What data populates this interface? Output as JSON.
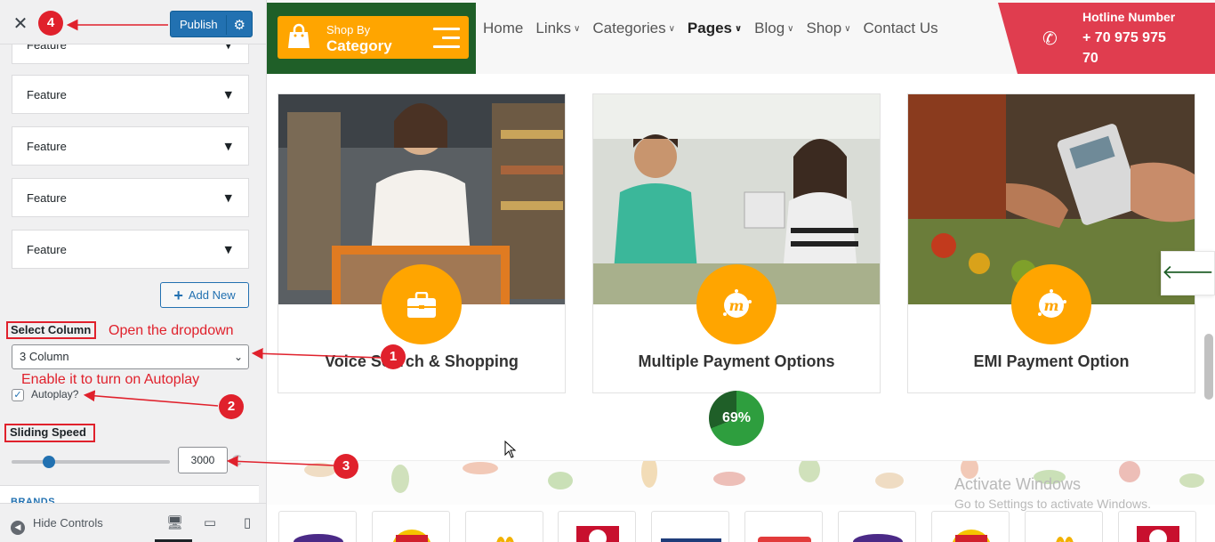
{
  "sidebar": {
    "close_glyph": "✕",
    "publish_label": "Publish",
    "features": [
      {
        "label": "Feature"
      },
      {
        "label": "Feature"
      },
      {
        "label": "Feature"
      },
      {
        "label": "Feature"
      },
      {
        "label": "Feature"
      }
    ],
    "add_new_label": "Add New",
    "select_column_label": "Select Column",
    "select_column_value": "3 Column",
    "autoplay_label": "Autoplay?",
    "autoplay_checked": true,
    "sliding_speed_label": "Sliding Speed",
    "sliding_speed_value": "3000",
    "brands_label": "BRANDS",
    "hide_controls_label": "Hide Controls"
  },
  "annotations": {
    "open_dropdown": "Open the dropdown",
    "enable_autoplay": "Enable it to turn on Autoplay",
    "badges": [
      "1",
      "2",
      "3",
      "4"
    ],
    "color": "#e0212c"
  },
  "site": {
    "category_small": "Shop By",
    "category_big": "Category",
    "nav": [
      {
        "label": "Home",
        "caret": false,
        "active": false
      },
      {
        "label": "Links",
        "caret": true,
        "active": false
      },
      {
        "label": "Categories",
        "caret": true,
        "active": false
      },
      {
        "label": "Pages",
        "caret": true,
        "active": true
      },
      {
        "label": "Blog",
        "caret": true,
        "active": false
      },
      {
        "label": "Shop",
        "caret": true,
        "active": false
      },
      {
        "label": "Contact Us",
        "caret": false,
        "active": false
      }
    ],
    "hotline_title": "Hotline Number",
    "hotline_number": "+ 70 975 975 70",
    "cards": [
      {
        "title": "Voice Search & Shopping",
        "icon": "briefcase-icon"
      },
      {
        "title": "Multiple Payment Options",
        "icon": "meetup-icon"
      },
      {
        "title": "EMI Payment Option",
        "icon": "meetup-icon"
      }
    ],
    "progress_percent": 69,
    "progress_label": "69%",
    "watermark_title": "Activate Windows",
    "watermark_sub": "Go to Settings to activate Windows.",
    "colors": {
      "brand_green": "#1f5f28",
      "accent_orange": "#ffa500",
      "hotline_red": "#e03d4f",
      "publish_blue": "#2271b1"
    }
  }
}
